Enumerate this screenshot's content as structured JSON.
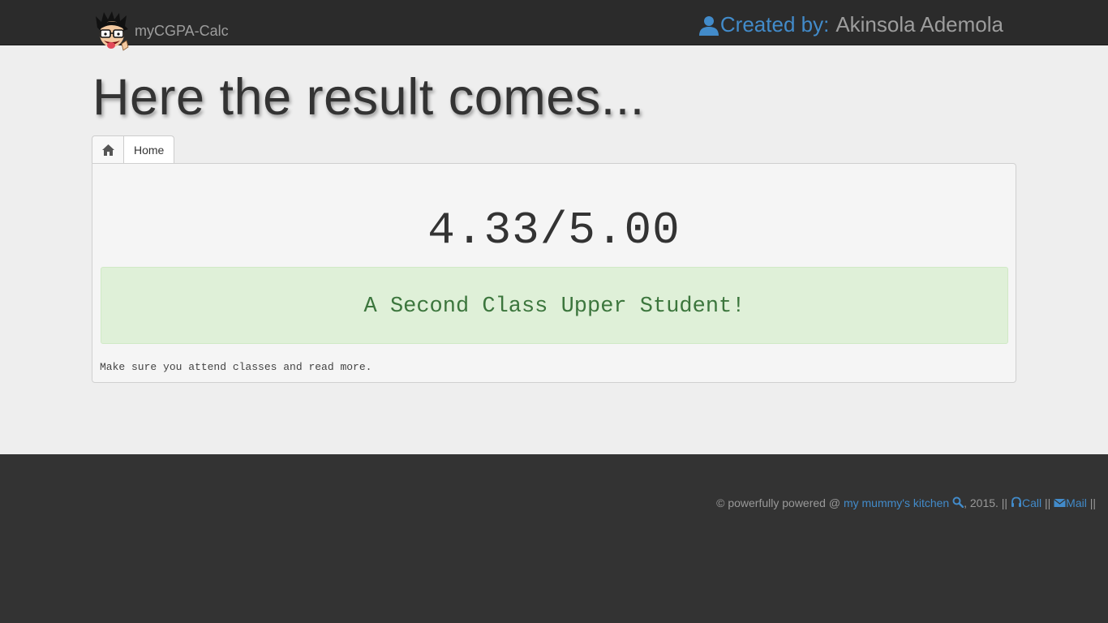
{
  "header": {
    "brand_name": "myCGPA-Calc",
    "creator_label": "Created by:",
    "creator_name": "Akinsola Ademola"
  },
  "page": {
    "title": "Here the result comes..."
  },
  "breadcrumb": {
    "home_label": "Home"
  },
  "result": {
    "score": "4.33/5.00",
    "classification": "A Second Class Upper Student!",
    "advice": "Make sure you attend classes and read more."
  },
  "footer": {
    "prefix": "© powerfully powered @ ",
    "kitchen_link": "my mummy's kitchen",
    "year_text": ", 2015. || ",
    "call_label": "Call",
    "separator": " || ",
    "mail_label": "Mail",
    "suffix": " ||"
  },
  "icons": {
    "avatar": "cartoon-avatar",
    "creator": "user-icon",
    "home": "home-icon",
    "search": "search-icon",
    "call": "headphones-icon",
    "mail": "envelope-icon"
  },
  "colors": {
    "navbar": "#2b2b2b",
    "link": "#428bca",
    "success_bg": "#dff0d8",
    "success_text": "#3c763d",
    "footer": "#333333"
  }
}
